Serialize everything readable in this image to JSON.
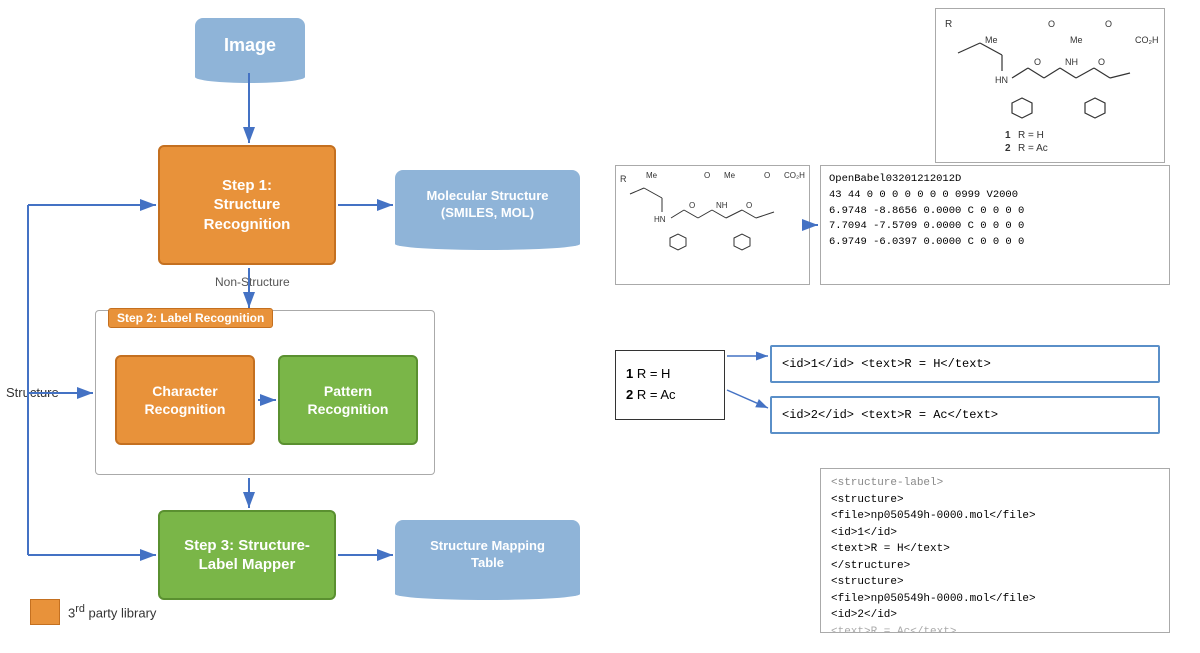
{
  "image_box": {
    "label": "Image"
  },
  "step1_box": {
    "label": "Step 1:\nStructure\nRecognition"
  },
  "mol_structure_box": {
    "label": "Molecular Structure\n(SMILES, MOL)"
  },
  "non_structure_label": {
    "text": "Non-Structure"
  },
  "step2_label": {
    "text": "Step 2: Label Recognition"
  },
  "char_recognition_box": {
    "label": "Character\nRecognition"
  },
  "pattern_recognition_box": {
    "label": "Pattern\nRecognition"
  },
  "step3_box": {
    "label": "Step 3: Structure-\nLabel Mapper"
  },
  "structure_mapping_box": {
    "label": "Structure Mapping\nTable"
  },
  "structure_label": {
    "text": "Structure"
  },
  "legend": {
    "text": "3rd party library",
    "sup": "rd"
  },
  "mol_code": {
    "line1": "OpenBabel03201212012D",
    "line2": " 43 44  0  0  0  0  0  0  0  0999 V2000",
    "line3": "    6.9748  -8.8656   0.0000 C   0  0  0  0",
    "line4": "    7.7094  -7.5709   0.0000 C   0  0  0  0",
    "line5": "    6.9749  -6.0397   0.0000 C   0  0  0  0"
  },
  "label_box": {
    "line1": "1  R = H",
    "line2": "2  R = Ac"
  },
  "id_box1": {
    "text": "<id>1</id> <text>R = H</text>"
  },
  "id_box2": {
    "text": "<id>2</id> <text>R = Ac</text>"
  },
  "xml_box": {
    "line1": "<structure-label>",
    "line2": "<structure>",
    "line3": "<file>np050549h-0000.mol</file>",
    "line4": "<id>1</id>",
    "line5": "<text>R = H</text>",
    "line6": "</structure>",
    "line7": "<structure>",
    "line8": "<file>np050549h-0000.mol</file>",
    "line9": "<id>2</id>",
    "line10": "<text>R = Ac</text>"
  }
}
